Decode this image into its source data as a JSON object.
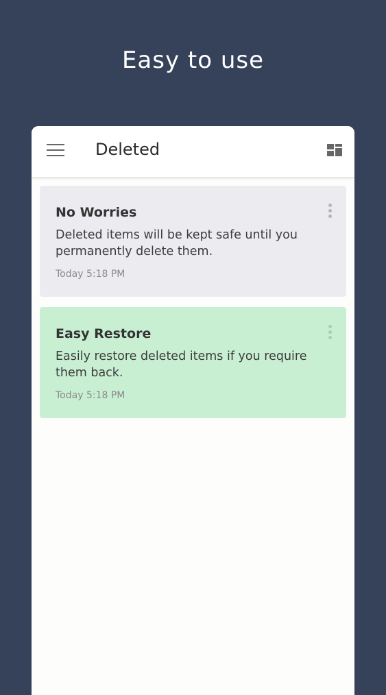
{
  "headline": "Easy to use",
  "appbar": {
    "title": "Deleted",
    "menu_icon": "hamburger-menu-icon",
    "view_icon": "grid-view-icon"
  },
  "notes": [
    {
      "title": "No Worries",
      "body": "Deleted items will be kept safe until you permanently delete them.",
      "time": "Today 5:18 PM",
      "color": "#ececf0"
    },
    {
      "title": "Easy Restore",
      "body": "Easily restore deleted items if you require them back.",
      "time": "Today 5:18 PM",
      "color": "#c9efd3"
    }
  ],
  "colors": {
    "background": "#36415a",
    "screen": "#fdfdfb"
  }
}
